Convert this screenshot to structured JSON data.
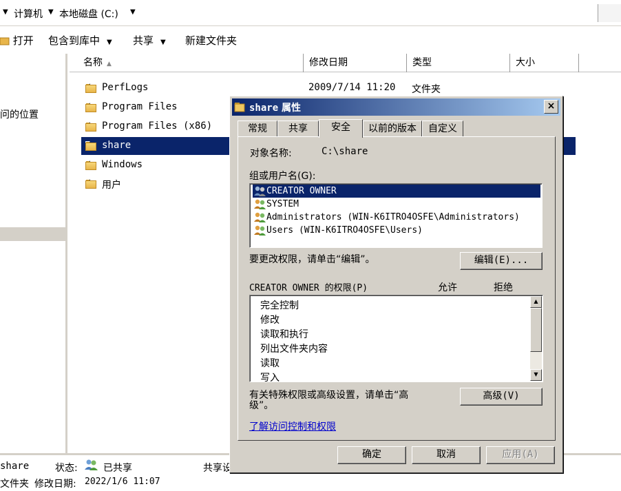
{
  "explorer": {
    "breadcrumb": [
      "计算机",
      "本地磁盘 (C:)"
    ],
    "toolbar": {
      "open": "打开",
      "include_in_library": "包含到库中",
      "share": "共享",
      "new_folder": "新建文件夹"
    },
    "nav_text": "问的位置",
    "columns": {
      "name": "名称",
      "date": "修改日期",
      "type": "类型",
      "size": "大小"
    },
    "files": [
      {
        "name": "PerfLogs",
        "date": "2009/7/14 11:20",
        "type": "文件夹"
      },
      {
        "name": "Program Files",
        "date": "",
        "type": ""
      },
      {
        "name": "Program Files (x86)",
        "date": "",
        "type": ""
      },
      {
        "name": "share",
        "date": "",
        "type": "",
        "selected": true
      },
      {
        "name": "Windows",
        "date": "",
        "type": ""
      },
      {
        "name": "用户",
        "date": "",
        "type": ""
      }
    ],
    "status": {
      "item_name": "share",
      "state_label": "状态:",
      "state_value": "已共享",
      "share_label": "共享设",
      "item_type": "文件夹",
      "modified_label": "修改日期:",
      "modified_value": "2022/1/6 11:07"
    }
  },
  "dialog": {
    "title_name": "share",
    "title_suffix": "属性",
    "close_symbol": "×",
    "tabs": [
      "常规",
      "共享",
      "安全",
      "以前的版本",
      "自定义"
    ],
    "active_tab": "安全",
    "object_label": "对象名称:",
    "object_value": "C:\\share",
    "group_label": "组或用户名(G):",
    "users": [
      {
        "text": "CREATOR OWNER",
        "selected": true
      },
      {
        "text": "SYSTEM",
        "selected": false
      },
      {
        "text": "Administrators (WIN-K6ITRO4OSFE\\Administrators)",
        "selected": false
      },
      {
        "text": "Users (WIN-K6ITRO4OSFE\\Users)",
        "selected": false
      }
    ],
    "change_hint": "要更改权限，请单击“编辑”。",
    "edit_button": "编辑(E)...",
    "perm_header": "CREATOR OWNER 的权限(P)",
    "allow_header": "允许",
    "deny_header": "拒绝",
    "permissions": [
      "完全控制",
      "修改",
      "读取和执行",
      "列出文件夹内容",
      "读取",
      "写入"
    ],
    "advanced_hint_line1": "有关特殊权限或高级设置，请单击“高",
    "advanced_hint_line2": "级”。",
    "advanced_button": "高级(V)",
    "learn_link": "了解访问控制和权限",
    "ok_button": "确定",
    "cancel_button": "取消",
    "apply_button": "应用(A)"
  },
  "colors": {
    "selection": "#0a246a",
    "dialog_face": "#d4d0c8",
    "titlebar_start": "#0a246a",
    "titlebar_end": "#a6caf0",
    "link": "#0000cc"
  }
}
